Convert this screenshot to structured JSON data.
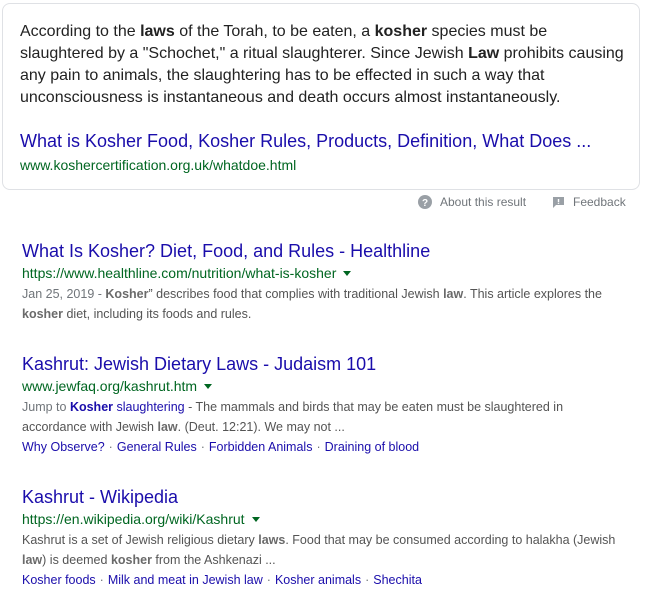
{
  "featured_snippet": {
    "text_parts": [
      {
        "t": "According to the ",
        "b": false
      },
      {
        "t": "laws",
        "b": true
      },
      {
        "t": " of the Torah, to be eaten, a ",
        "b": false
      },
      {
        "t": "kosher",
        "b": true
      },
      {
        "t": " species must be slaughtered by a \"Schochet,\" a ritual slaughterer. Since Jewish ",
        "b": false
      },
      {
        "t": "Law",
        "b": true
      },
      {
        "t": " prohibits causing any pain to animals, the slaughtering has to be effected in such a way that unconsciousness is instantaneous and death occurs almost instantaneously.",
        "b": false
      }
    ],
    "link_title": "What is Kosher Food, Kosher Rules, Products, Definition, What Does ...",
    "link_url": "www.koshercertification.org.uk/whatdoe.html"
  },
  "about_row": {
    "about_icon": "help-circle-icon",
    "about_label": "About this result",
    "feedback_icon": "feedback-flag-icon",
    "feedback_label": "Feedback"
  },
  "results": [
    {
      "title": "What Is Kosher? Diet, Food, and Rules - Healthline",
      "url": "https://www.healthline.com/nutrition/what-is-kosher",
      "desc_parts": [
        {
          "t": "Jan 25, 2019 - ",
          "k": "date"
        },
        {
          "t": "Kosher",
          "k": "b"
        },
        {
          "t": "” describes food that complies with traditional Jewish ",
          "k": ""
        },
        {
          "t": "law",
          "k": "b"
        },
        {
          "t": ". This article explores the ",
          "k": ""
        },
        {
          "t": "kosher",
          "k": "b"
        },
        {
          "t": " diet, including its foods and rules.",
          "k": ""
        }
      ],
      "sitelinks": []
    },
    {
      "title": "Kashrut: Jewish Dietary Laws - Judaism 101",
      "url": "www.jewfaq.org/kashrut.htm",
      "desc_parts": [
        {
          "t": "Jump to ",
          "k": "date"
        },
        {
          "t": "Kosher",
          "k": "linkb"
        },
        {
          "t": " slaughtering",
          "k": "link"
        },
        {
          "t": " - The mammals and birds that may be eaten must be slaughtered in accordance with Jewish ",
          "k": ""
        },
        {
          "t": "law",
          "k": "b"
        },
        {
          "t": ". (Deut. 12:21). We may not ...",
          "k": ""
        }
      ],
      "sitelinks": [
        "Why Observe?",
        "General Rules",
        "Forbidden Animals",
        "Draining of blood"
      ]
    },
    {
      "title": "Kashrut - Wikipedia",
      "url": "https://en.wikipedia.org/wiki/Kashrut",
      "desc_parts": [
        {
          "t": "Kashrut is a set of Jewish religious dietary ",
          "k": ""
        },
        {
          "t": "laws",
          "k": "b"
        },
        {
          "t": ". Food that may be consumed according to halakha (Jewish ",
          "k": ""
        },
        {
          "t": "law",
          "k": "b"
        },
        {
          "t": ") is deemed ",
          "k": ""
        },
        {
          "t": "kosher",
          "k": "b"
        },
        {
          "t": " from the Ashkenazi ...",
          "k": ""
        }
      ],
      "sitelinks": [
        "Kosher foods",
        "Milk and meat in Jewish law",
        "Kosher animals",
        "Shechita"
      ]
    }
  ],
  "colors": {
    "link": "#1a0dab",
    "url": "#006621",
    "text": "#545454",
    "muted": "#70757a"
  }
}
